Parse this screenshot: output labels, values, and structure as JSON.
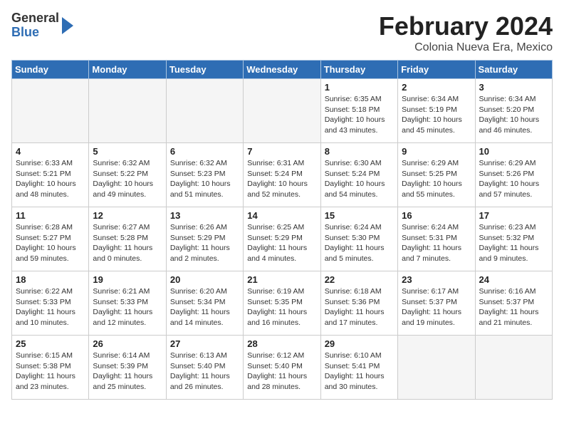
{
  "header": {
    "logo_general": "General",
    "logo_blue": "Blue",
    "title": "February 2024",
    "subtitle": "Colonia Nueva Era, Mexico"
  },
  "days_of_week": [
    "Sunday",
    "Monday",
    "Tuesday",
    "Wednesday",
    "Thursday",
    "Friday",
    "Saturday"
  ],
  "weeks": [
    [
      {
        "day": "",
        "info": ""
      },
      {
        "day": "",
        "info": ""
      },
      {
        "day": "",
        "info": ""
      },
      {
        "day": "",
        "info": ""
      },
      {
        "day": "1",
        "info": "Sunrise: 6:35 AM\nSunset: 5:18 PM\nDaylight: 10 hours\nand 43 minutes."
      },
      {
        "day": "2",
        "info": "Sunrise: 6:34 AM\nSunset: 5:19 PM\nDaylight: 10 hours\nand 45 minutes."
      },
      {
        "day": "3",
        "info": "Sunrise: 6:34 AM\nSunset: 5:20 PM\nDaylight: 10 hours\nand 46 minutes."
      }
    ],
    [
      {
        "day": "4",
        "info": "Sunrise: 6:33 AM\nSunset: 5:21 PM\nDaylight: 10 hours\nand 48 minutes."
      },
      {
        "day": "5",
        "info": "Sunrise: 6:32 AM\nSunset: 5:22 PM\nDaylight: 10 hours\nand 49 minutes."
      },
      {
        "day": "6",
        "info": "Sunrise: 6:32 AM\nSunset: 5:23 PM\nDaylight: 10 hours\nand 51 minutes."
      },
      {
        "day": "7",
        "info": "Sunrise: 6:31 AM\nSunset: 5:24 PM\nDaylight: 10 hours\nand 52 minutes."
      },
      {
        "day": "8",
        "info": "Sunrise: 6:30 AM\nSunset: 5:24 PM\nDaylight: 10 hours\nand 54 minutes."
      },
      {
        "day": "9",
        "info": "Sunrise: 6:29 AM\nSunset: 5:25 PM\nDaylight: 10 hours\nand 55 minutes."
      },
      {
        "day": "10",
        "info": "Sunrise: 6:29 AM\nSunset: 5:26 PM\nDaylight: 10 hours\nand 57 minutes."
      }
    ],
    [
      {
        "day": "11",
        "info": "Sunrise: 6:28 AM\nSunset: 5:27 PM\nDaylight: 10 hours\nand 59 minutes."
      },
      {
        "day": "12",
        "info": "Sunrise: 6:27 AM\nSunset: 5:28 PM\nDaylight: 11 hours\nand 0 minutes."
      },
      {
        "day": "13",
        "info": "Sunrise: 6:26 AM\nSunset: 5:29 PM\nDaylight: 11 hours\nand 2 minutes."
      },
      {
        "day": "14",
        "info": "Sunrise: 6:25 AM\nSunset: 5:29 PM\nDaylight: 11 hours\nand 4 minutes."
      },
      {
        "day": "15",
        "info": "Sunrise: 6:24 AM\nSunset: 5:30 PM\nDaylight: 11 hours\nand 5 minutes."
      },
      {
        "day": "16",
        "info": "Sunrise: 6:24 AM\nSunset: 5:31 PM\nDaylight: 11 hours\nand 7 minutes."
      },
      {
        "day": "17",
        "info": "Sunrise: 6:23 AM\nSunset: 5:32 PM\nDaylight: 11 hours\nand 9 minutes."
      }
    ],
    [
      {
        "day": "18",
        "info": "Sunrise: 6:22 AM\nSunset: 5:33 PM\nDaylight: 11 hours\nand 10 minutes."
      },
      {
        "day": "19",
        "info": "Sunrise: 6:21 AM\nSunset: 5:33 PM\nDaylight: 11 hours\nand 12 minutes."
      },
      {
        "day": "20",
        "info": "Sunrise: 6:20 AM\nSunset: 5:34 PM\nDaylight: 11 hours\nand 14 minutes."
      },
      {
        "day": "21",
        "info": "Sunrise: 6:19 AM\nSunset: 5:35 PM\nDaylight: 11 hours\nand 16 minutes."
      },
      {
        "day": "22",
        "info": "Sunrise: 6:18 AM\nSunset: 5:36 PM\nDaylight: 11 hours\nand 17 minutes."
      },
      {
        "day": "23",
        "info": "Sunrise: 6:17 AM\nSunset: 5:37 PM\nDaylight: 11 hours\nand 19 minutes."
      },
      {
        "day": "24",
        "info": "Sunrise: 6:16 AM\nSunset: 5:37 PM\nDaylight: 11 hours\nand 21 minutes."
      }
    ],
    [
      {
        "day": "25",
        "info": "Sunrise: 6:15 AM\nSunset: 5:38 PM\nDaylight: 11 hours\nand 23 minutes."
      },
      {
        "day": "26",
        "info": "Sunrise: 6:14 AM\nSunset: 5:39 PM\nDaylight: 11 hours\nand 25 minutes."
      },
      {
        "day": "27",
        "info": "Sunrise: 6:13 AM\nSunset: 5:40 PM\nDaylight: 11 hours\nand 26 minutes."
      },
      {
        "day": "28",
        "info": "Sunrise: 6:12 AM\nSunset: 5:40 PM\nDaylight: 11 hours\nand 28 minutes."
      },
      {
        "day": "29",
        "info": "Sunrise: 6:10 AM\nSunset: 5:41 PM\nDaylight: 11 hours\nand 30 minutes."
      },
      {
        "day": "",
        "info": ""
      },
      {
        "day": "",
        "info": ""
      }
    ]
  ]
}
